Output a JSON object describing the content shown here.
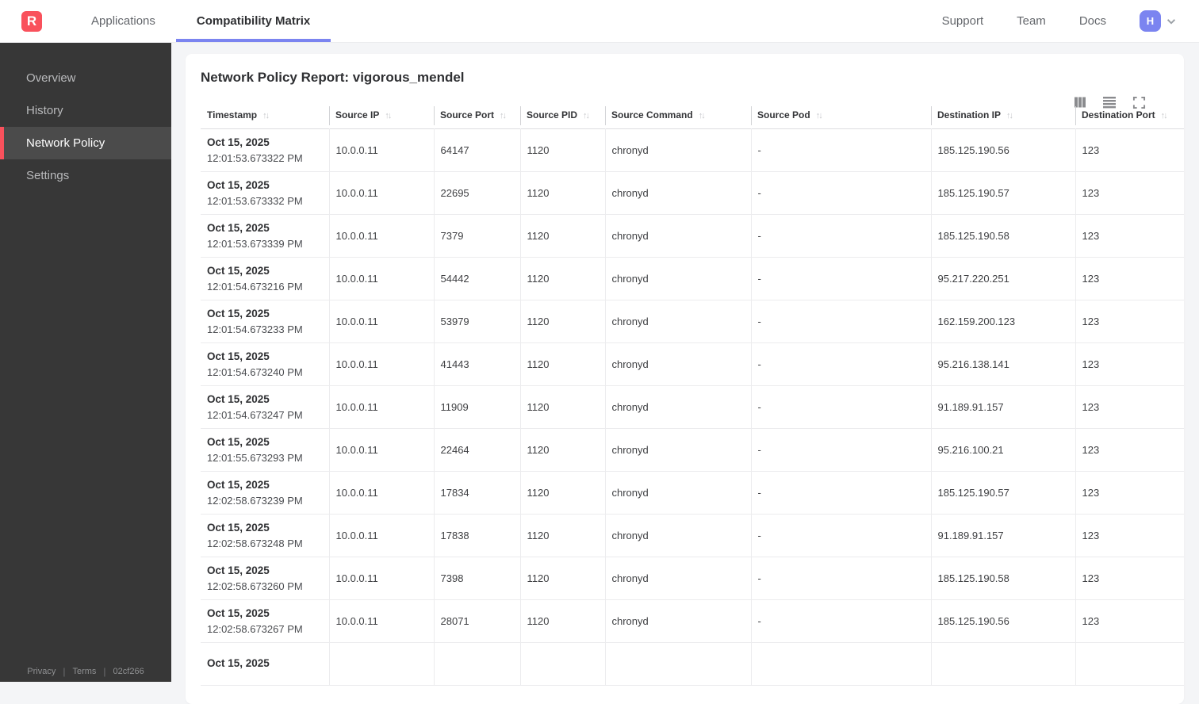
{
  "topbar": {
    "logo_letter": "R",
    "tabs": [
      {
        "label": "Applications",
        "active": false
      },
      {
        "label": "Compatibility Matrix",
        "active": true
      }
    ],
    "links": [
      "Support",
      "Team",
      "Docs"
    ],
    "avatar_letter": "H"
  },
  "sidebar": {
    "items": [
      {
        "label": "Overview",
        "active": false
      },
      {
        "label": "History",
        "active": false
      },
      {
        "label": "Network Policy",
        "active": true
      },
      {
        "label": "Settings",
        "active": false
      }
    ],
    "footer": {
      "privacy": "Privacy",
      "terms": "Terms",
      "build_id": "02cf266"
    }
  },
  "main": {
    "title": "Network Policy Report: vigorous_mendel",
    "toolbar_icons": [
      "columns-icon",
      "rows-icon",
      "fullscreen-icon"
    ]
  },
  "table": {
    "columns": [
      {
        "key": "timestamp",
        "label": "Timestamp"
      },
      {
        "key": "source_ip",
        "label": "Source IP"
      },
      {
        "key": "source_port",
        "label": "Source Port"
      },
      {
        "key": "source_pid",
        "label": "Source PID"
      },
      {
        "key": "source_command",
        "label": "Source Command"
      },
      {
        "key": "source_pod",
        "label": "Source Pod"
      },
      {
        "key": "dest_ip",
        "label": "Destination IP"
      },
      {
        "key": "dest_port",
        "label": "Destination Port"
      }
    ],
    "sort_icon": "↑↓",
    "rows": [
      {
        "date": "Oct 15, 2025",
        "time": "12:01:53.673322 PM",
        "source_ip": "10.0.0.11",
        "source_port": "64147",
        "source_pid": "1120",
        "source_command": "chronyd",
        "source_pod": "-",
        "dest_ip": "185.125.190.56",
        "dest_port": "123"
      },
      {
        "date": "Oct 15, 2025",
        "time": "12:01:53.673332 PM",
        "source_ip": "10.0.0.11",
        "source_port": "22695",
        "source_pid": "1120",
        "source_command": "chronyd",
        "source_pod": "-",
        "dest_ip": "185.125.190.57",
        "dest_port": "123"
      },
      {
        "date": "Oct 15, 2025",
        "time": "12:01:53.673339 PM",
        "source_ip": "10.0.0.11",
        "source_port": "7379",
        "source_pid": "1120",
        "source_command": "chronyd",
        "source_pod": "-",
        "dest_ip": "185.125.190.58",
        "dest_port": "123"
      },
      {
        "date": "Oct 15, 2025",
        "time": "12:01:54.673216 PM",
        "source_ip": "10.0.0.11",
        "source_port": "54442",
        "source_pid": "1120",
        "source_command": "chronyd",
        "source_pod": "-",
        "dest_ip": "95.217.220.251",
        "dest_port": "123"
      },
      {
        "date": "Oct 15, 2025",
        "time": "12:01:54.673233 PM",
        "source_ip": "10.0.0.11",
        "source_port": "53979",
        "source_pid": "1120",
        "source_command": "chronyd",
        "source_pod": "-",
        "dest_ip": "162.159.200.123",
        "dest_port": "123"
      },
      {
        "date": "Oct 15, 2025",
        "time": "12:01:54.673240 PM",
        "source_ip": "10.0.0.11",
        "source_port": "41443",
        "source_pid": "1120",
        "source_command": "chronyd",
        "source_pod": "-",
        "dest_ip": "95.216.138.141",
        "dest_port": "123"
      },
      {
        "date": "Oct 15, 2025",
        "time": "12:01:54.673247 PM",
        "source_ip": "10.0.0.11",
        "source_port": "11909",
        "source_pid": "1120",
        "source_command": "chronyd",
        "source_pod": "-",
        "dest_ip": "91.189.91.157",
        "dest_port": "123"
      },
      {
        "date": "Oct 15, 2025",
        "time": "12:01:55.673293 PM",
        "source_ip": "10.0.0.11",
        "source_port": "22464",
        "source_pid": "1120",
        "source_command": "chronyd",
        "source_pod": "-",
        "dest_ip": "95.216.100.21",
        "dest_port": "123"
      },
      {
        "date": "Oct 15, 2025",
        "time": "12:02:58.673239 PM",
        "source_ip": "10.0.0.11",
        "source_port": "17834",
        "source_pid": "1120",
        "source_command": "chronyd",
        "source_pod": "-",
        "dest_ip": "185.125.190.57",
        "dest_port": "123"
      },
      {
        "date": "Oct 15, 2025",
        "time": "12:02:58.673248 PM",
        "source_ip": "10.0.0.11",
        "source_port": "17838",
        "source_pid": "1120",
        "source_command": "chronyd",
        "source_pod": "-",
        "dest_ip": "91.189.91.157",
        "dest_port": "123"
      },
      {
        "date": "Oct 15, 2025",
        "time": "12:02:58.673260 PM",
        "source_ip": "10.0.0.11",
        "source_port": "7398",
        "source_pid": "1120",
        "source_command": "chronyd",
        "source_pod": "-",
        "dest_ip": "185.125.190.58",
        "dest_port": "123"
      },
      {
        "date": "Oct 15, 2025",
        "time": "12:02:58.673267 PM",
        "source_ip": "10.0.0.11",
        "source_port": "28071",
        "source_pid": "1120",
        "source_command": "chronyd",
        "source_pod": "-",
        "dest_ip": "185.125.190.56",
        "dest_port": "123"
      },
      {
        "date": "Oct 15, 2025",
        "time": "",
        "source_ip": "",
        "source_port": "",
        "source_pid": "",
        "source_command": "",
        "source_pod": "",
        "dest_ip": "",
        "dest_port": ""
      }
    ]
  },
  "colors": {
    "accent_indigo": "#7b84f0",
    "brand_red": "#f9515c",
    "sidebar_bg": "#373737",
    "sidebar_active_bg": "#4b4b4b",
    "page_bg": "#f4f5f7"
  }
}
